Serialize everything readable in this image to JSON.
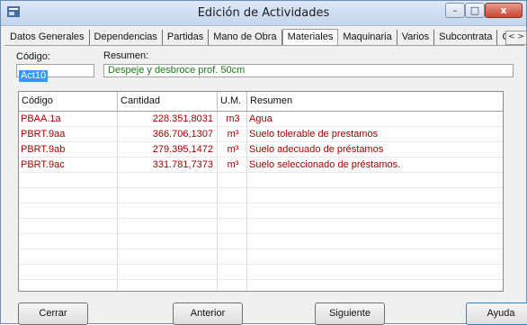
{
  "window": {
    "title": "Edición de Actividades",
    "close_label": "x",
    "min_label": "–",
    "max_label": "□"
  },
  "tabs": [
    {
      "label": "Datos Generales"
    },
    {
      "label": "Dependencias"
    },
    {
      "label": "Partidas"
    },
    {
      "label": "Mano de Obra"
    },
    {
      "label": "Materiales"
    },
    {
      "label": "Maquinaria"
    },
    {
      "label": "Varios"
    },
    {
      "label": "Subcontrata"
    },
    {
      "label": "Gráfico e"
    }
  ],
  "active_tab": "Materiales",
  "form": {
    "codigo_label": "Código:",
    "codigo_value": "Act10",
    "resumen_label": "Resumen:",
    "resumen_value": "Despeje y desbroce prof. 50cm"
  },
  "table": {
    "headers": [
      "Código",
      "Cantidad",
      "U.M.",
      "Resumen"
    ],
    "rows": [
      {
        "codigo": "PBAA.1a",
        "cantidad": "228.351,8031",
        "um": "m3",
        "resumen": "Agua"
      },
      {
        "codigo": "PBRT.9aa",
        "cantidad": "366.706,1307",
        "um": "m³",
        "resumen": "Suelo tolerable de prestamos"
      },
      {
        "codigo": "PBRT.9ab",
        "cantidad": "279.395,1472",
        "um": "m³",
        "resumen": "Suelo adecuado de préstamos"
      },
      {
        "codigo": "PBRT.9ac",
        "cantidad": "331.781,7373",
        "um": "m³",
        "resumen": "Suelo seleccionado de préstamos."
      }
    ]
  },
  "buttons": {
    "cerrar": "Cerrar",
    "anterior": "Anterior",
    "siguiente": "Siguiente",
    "ayuda": "Ayuda"
  },
  "colors": {
    "data_text": "#a60000",
    "resumen_text": "#1c7a18",
    "selection": "#3399ff"
  }
}
